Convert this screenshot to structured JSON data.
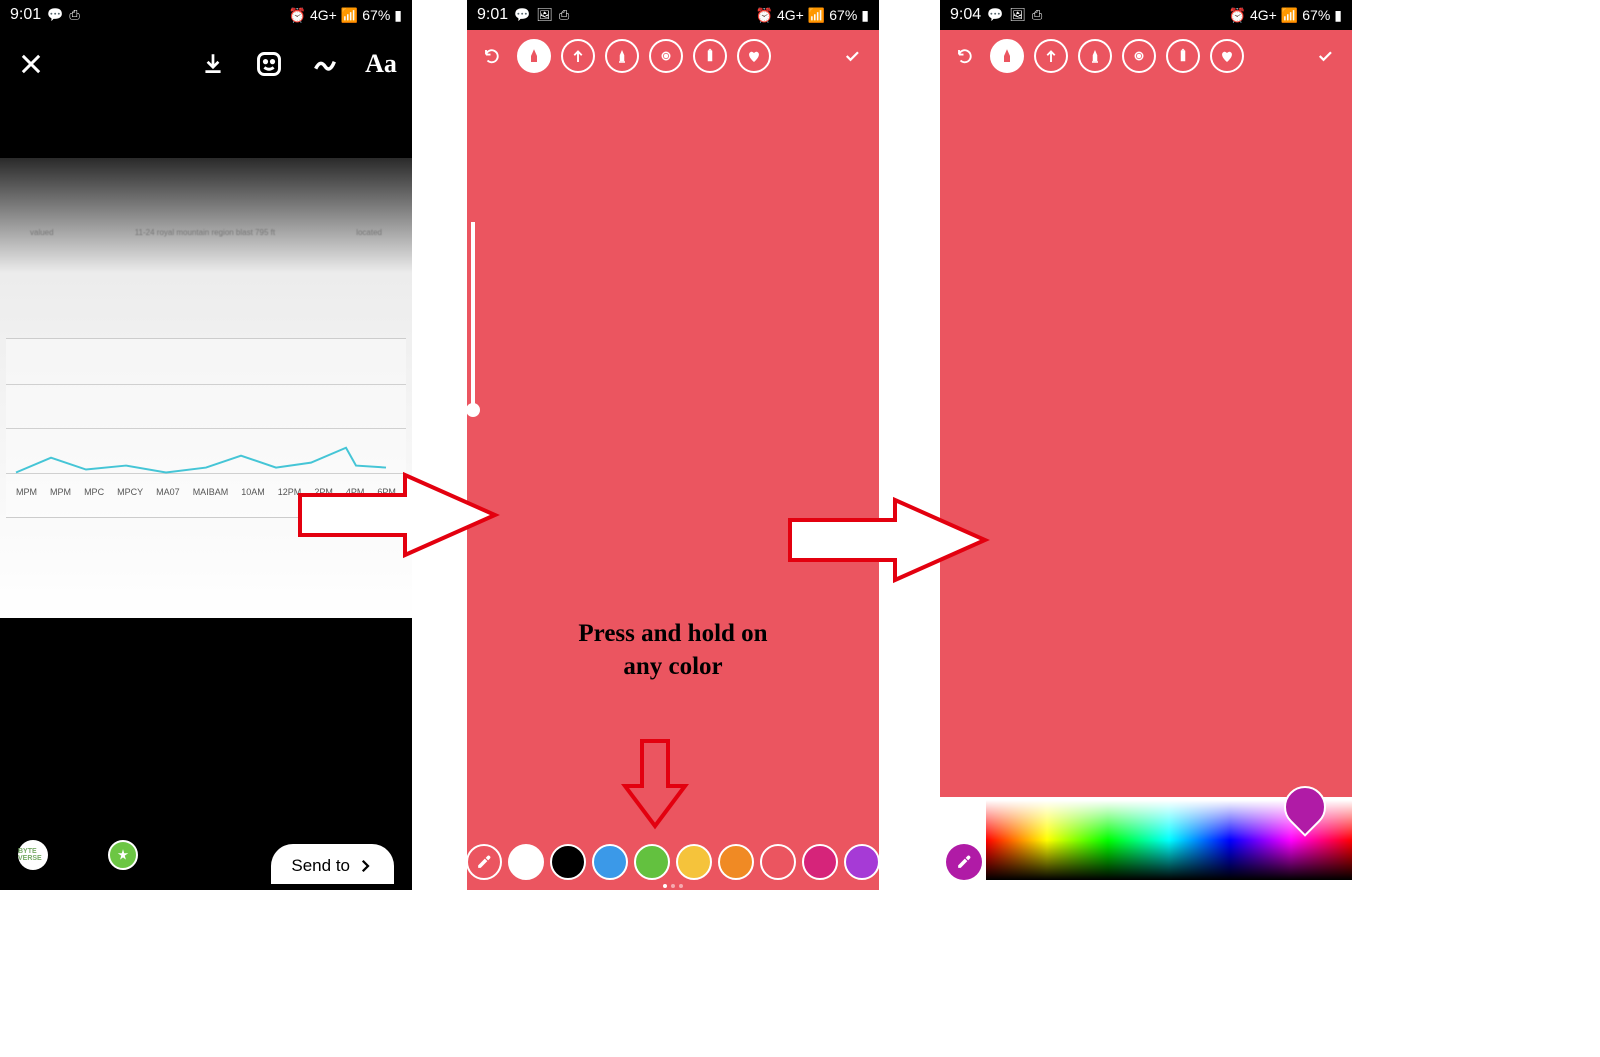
{
  "statusbar": {
    "time_a": "9:01",
    "time_b": "9:04",
    "battery": "67%",
    "network": "4G+"
  },
  "phone1": {
    "send_to": "Send to",
    "chart_xlabels": [
      "MPM",
      "MPM",
      "MPC",
      "MPCY",
      "MA07",
      "MAIBAM",
      "10AM",
      "12PM",
      "2PM",
      "4PM",
      "6PM"
    ],
    "blur_left": "valued",
    "blur_mid": "11-24 royal mountain region blast 795 ft",
    "blur_right": "located"
  },
  "phone2": {
    "instruction_line1": "Press and  hold on",
    "instruction_line2": "any color",
    "tools": [
      "undo",
      "marker",
      "arrow",
      "highlighter",
      "neon",
      "chisel",
      "heart",
      "done"
    ],
    "colors": [
      {
        "name": "eyedropper",
        "hex": "eyedrop"
      },
      {
        "name": "white",
        "hex": "#ffffff"
      },
      {
        "name": "black",
        "hex": "#000000"
      },
      {
        "name": "blue",
        "hex": "#3b99e8"
      },
      {
        "name": "green",
        "hex": "#63c13f"
      },
      {
        "name": "yellow",
        "hex": "#f5c33b"
      },
      {
        "name": "orange",
        "hex": "#f08a24"
      },
      {
        "name": "coral",
        "hex": "#eb5560"
      },
      {
        "name": "magenta",
        "hex": "#d6247a"
      },
      {
        "name": "purple",
        "hex": "#a63ad6"
      }
    ]
  },
  "phone3": {
    "tools": [
      "undo",
      "marker",
      "arrow",
      "highlighter",
      "neon",
      "chisel",
      "heart",
      "done"
    ],
    "picker_color": "#b01ba6"
  },
  "accent": "#eb5560"
}
